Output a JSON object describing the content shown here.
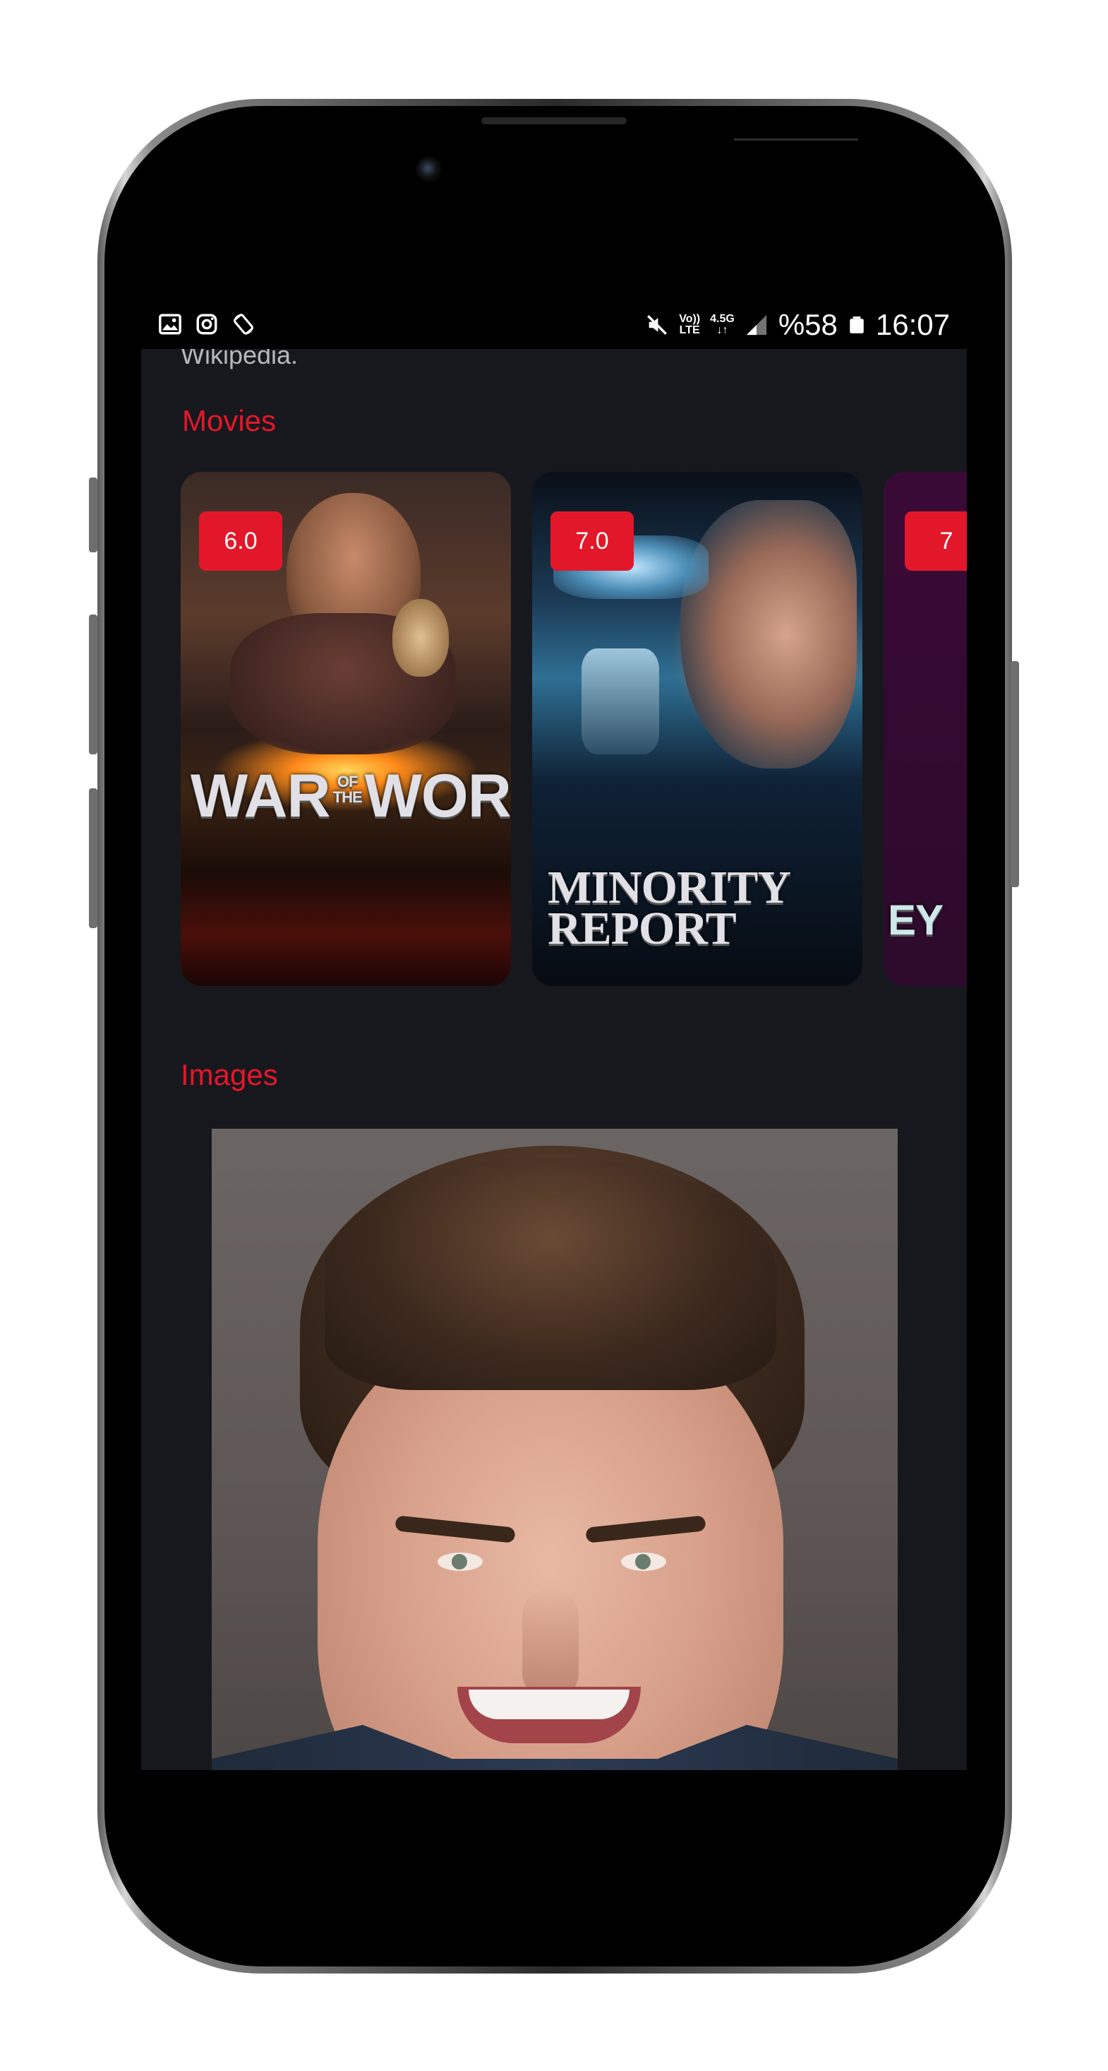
{
  "status_bar": {
    "left_icons": [
      "gallery-icon",
      "instagram-icon",
      "screen-rotation-icon"
    ],
    "network": {
      "volte_top": "Vo))",
      "volte_bottom": "LTE",
      "gen": "4.5G",
      "gen_sub": "↓↑"
    },
    "battery_percent": "%58",
    "time": "16:07"
  },
  "content": {
    "cut_text": "Wikipedia.",
    "movies_title": "Movies",
    "images_title": "Images",
    "movies": [
      {
        "rating": "6.0",
        "poster_title_line1": "WAR",
        "poster_title_small": "OF THE",
        "poster_title_line2": "WORLDS"
      },
      {
        "rating": "7.0",
        "poster_title_line1": "MINORITY",
        "poster_title_line2": "REPORT"
      },
      {
        "rating": "7",
        "poster_title_line1": "EY"
      }
    ]
  },
  "colors": {
    "accent": "#e3172a",
    "background": "#17181d",
    "text_muted": "#b8b8bc"
  }
}
